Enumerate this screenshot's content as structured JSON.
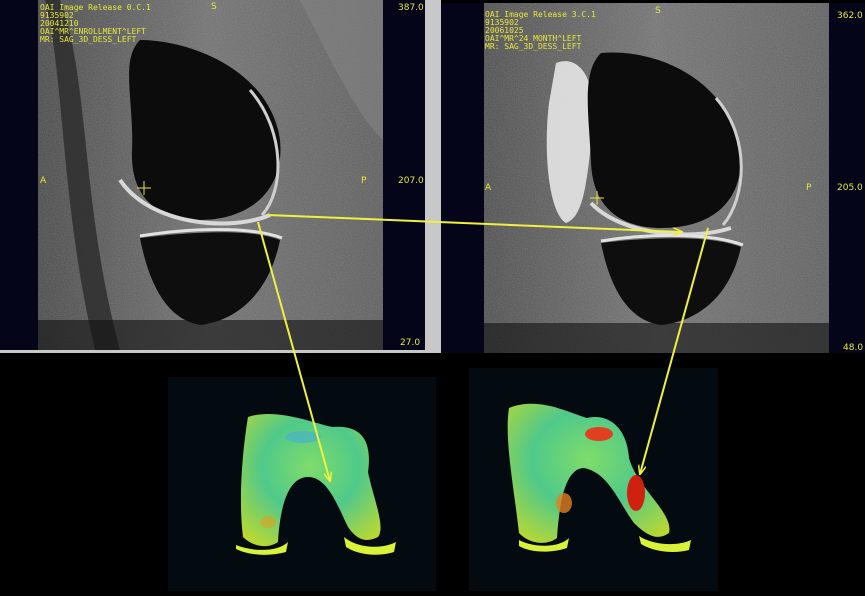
{
  "viewers": [
    {
      "info": [
        "OAI Image Release 0.C.1",
        "9135902",
        "20041210",
        "OAI^MR^ENROLLMENT^LEFT",
        "MR: SAG_3D_DESS_LEFT"
      ],
      "top_label": "S",
      "left_label": "A",
      "right_label": "P",
      "scale_top": "387.0",
      "scale_mid": "207.0",
      "scale_bottom": "27.0"
    },
    {
      "info": [
        "OAI Image Release 3.C.1",
        "9135902",
        "20061025",
        "OAI^MR^24 MONTH^LEFT",
        "MR: SAG_3D_DESS_LEFT"
      ],
      "top_label": "S",
      "left_label": "A",
      "right_label": "P",
      "scale_top": "362.0",
      "scale_mid": "205.0",
      "scale_bottom": "48.0"
    }
  ],
  "colors": {
    "annotation": "#e8e83a",
    "separator": "#c8c8c8",
    "background": "#000000"
  }
}
